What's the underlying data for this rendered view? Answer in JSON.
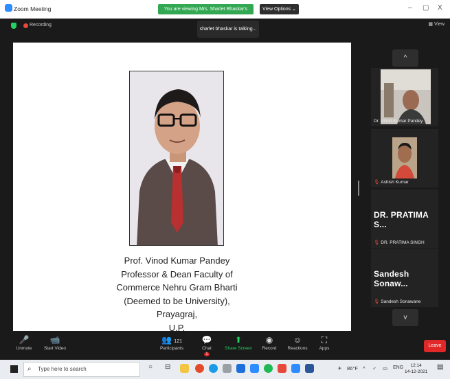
{
  "window": {
    "title": "Zoom Meeting",
    "min": "–",
    "restore": "▢",
    "close": "X"
  },
  "banner": {
    "viewing": "You are viewing Mrs. Sharlet Bhaskar's screen",
    "view_options": "View Options ⌄"
  },
  "status": {
    "recording": "Recording",
    "talking": "sharlet bhaskar is talking...",
    "view": "View"
  },
  "shared": {
    "caption": [
      "Prof. Vinod Kumar Pandey",
      "Professor & Dean Faculty of",
      "Commerce Nehru Gram Bharti",
      "(Deemed to be University), Prayagraj,",
      "U.P."
    ]
  },
  "participants_panel": {
    "up": "^",
    "down": "v",
    "tiles": [
      {
        "name": "Dr. Vinod Kumar Pandey",
        "big": ""
      },
      {
        "name": "Ashish Kumar",
        "big": ""
      },
      {
        "name": "DR. PRATIMA SINGH",
        "big": "DR. PRATIMA S..."
      },
      {
        "name": "Sandesh Sonawane",
        "big": "Sandesh Sonaw..."
      }
    ]
  },
  "toolbar": {
    "unmute": "Unmute",
    "start_video": "Start Video",
    "participants": "Participants",
    "participants_count": "121",
    "chat": "Chat",
    "chat_badge": "1",
    "share": "Share Screen",
    "record": "Record",
    "reactions": "Reactions",
    "apps": "Apps",
    "leave": "Leave"
  },
  "taskbar": {
    "search_placeholder": "Type here to search",
    "weather": "86°F",
    "lang": "ENG",
    "time": "12:14",
    "date": "14-12-2021"
  },
  "colors": {
    "green": "#32a852",
    "zoom_blue": "#2d8cff",
    "red": "#e02828"
  }
}
